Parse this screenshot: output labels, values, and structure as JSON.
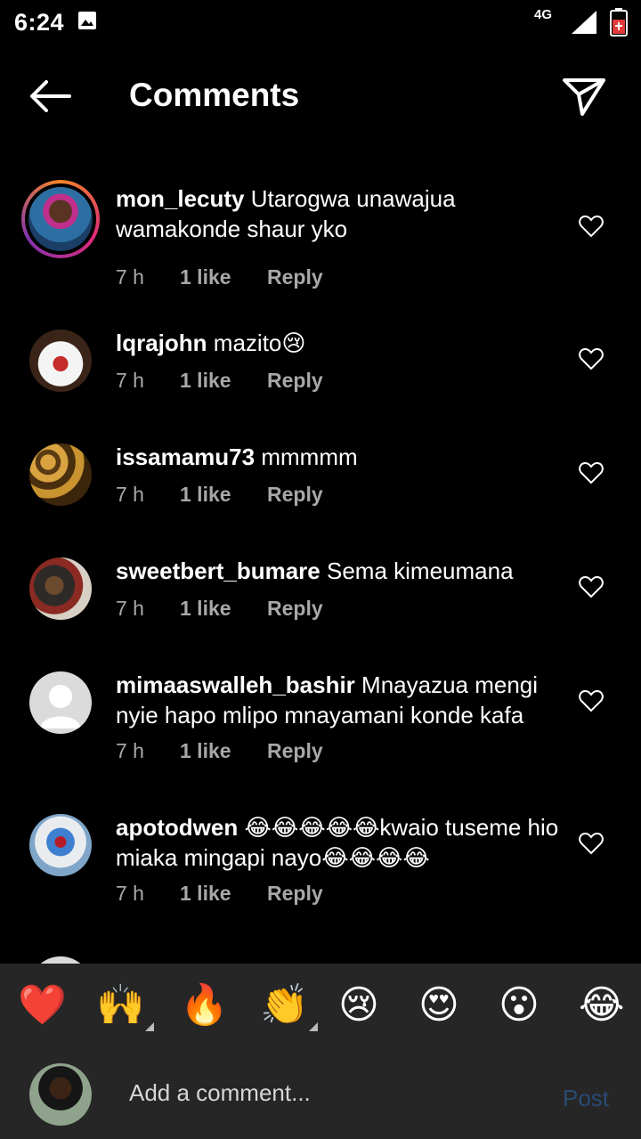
{
  "status_bar": {
    "time": "6:24",
    "network": "4G"
  },
  "header": {
    "title": "Comments",
    "back_icon": "arrow-left-icon",
    "send_icon": "paper-plane-icon"
  },
  "comments": [
    {
      "username": "mon_lecuty",
      "text": "Utarogwa unawajua wamakonde shaur yko",
      "time": "7 h",
      "likes": "1 like",
      "reply": "Reply"
    },
    {
      "username": "lqrajohn",
      "text": "mazito😢",
      "time": "7 h",
      "likes": "1 like",
      "reply": "Reply"
    },
    {
      "username": "issamamu73",
      "text": "mmmmm",
      "time": "7 h",
      "likes": "1 like",
      "reply": "Reply"
    },
    {
      "username": "sweetbert_bumare",
      "text": "Sema kimeumana",
      "time": "7 h",
      "likes": "1 like",
      "reply": "Reply"
    },
    {
      "username": "mimaaswalleh_bashir",
      "text": "Mnayazua mengi nyie hapo mlipo mnayamani konde kafa",
      "time": "7 h",
      "likes": "1 like",
      "reply": "Reply"
    },
    {
      "username": "apotodwen",
      "text": "😂😂😂😂😂kwaio tuseme hio miaka mingapi nayo😂😂😂😂",
      "time": "7 h",
      "likes": "1 like",
      "reply": "Reply"
    }
  ],
  "quick_reactions": [
    "❤️",
    "🙌",
    "🔥",
    "👏",
    "😢",
    "😍",
    "😮",
    "😂"
  ],
  "composer": {
    "placeholder": "Add a comment...",
    "post_label": "Post"
  },
  "colors": {
    "background": "#000000",
    "meta_text": "#a8a8a8",
    "post_disabled": "#2a4a74",
    "bar": "#262626"
  }
}
